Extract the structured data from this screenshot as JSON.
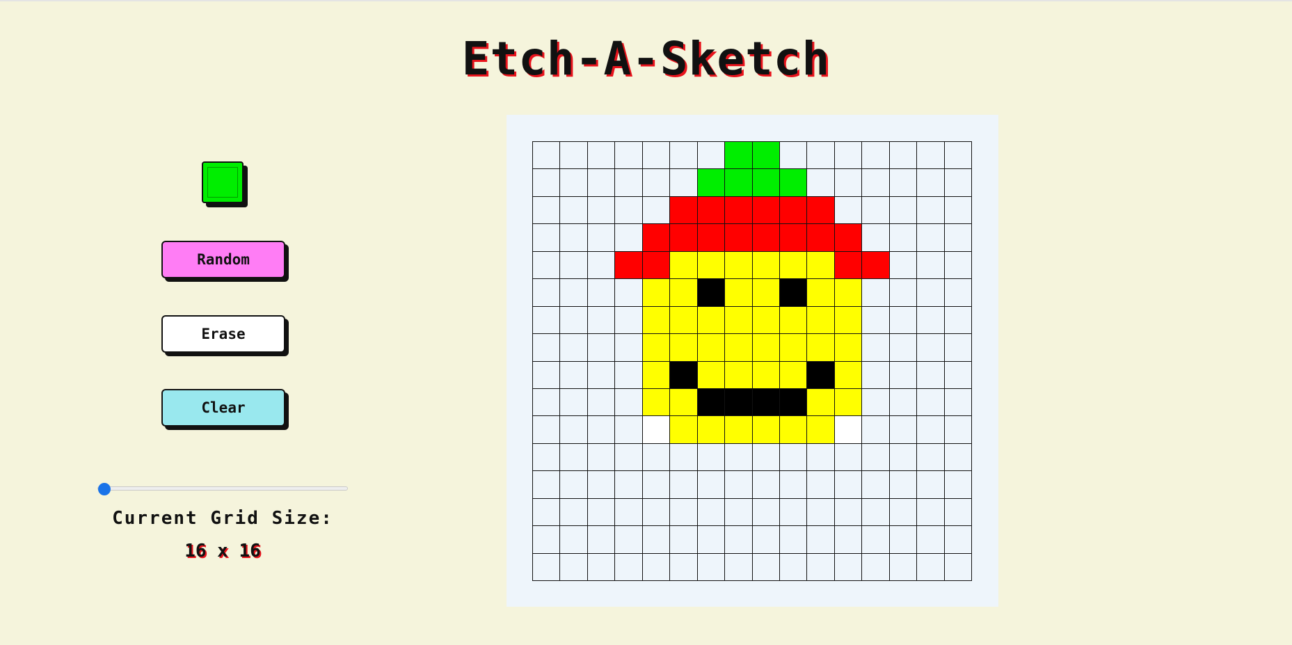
{
  "title": "Etch-A-Sketch",
  "current_color": "#00ee00",
  "buttons": {
    "random": {
      "label": "Random",
      "color": "#ff7df5"
    },
    "erase": {
      "label": "Erase",
      "color": "#ffffff"
    },
    "clear": {
      "label": "Clear",
      "color": "#99e8ee"
    }
  },
  "grid_size": {
    "label": "Current Grid Size:",
    "value": "16 x 16",
    "slider_value": 16
  },
  "palette": {
    "b": "#eef5fb",
    "G": "#00ee00",
    "R": "#ff0000",
    "Y": "#ffff00",
    "K": "#000000",
    "W": "#ffffff"
  },
  "grid_cells": [
    "bbbbbbbGGbbbbbbb",
    "bbbbbbGGGGbbbbbb",
    "bbbbbRRRRRRbbbbb",
    "bbbbRRRRRRRRbbbb",
    "bbbRRYYYYYYRRbbb",
    "bbbbYYKYYKYYbbbb",
    "bbbbYYYYYYYYbbbb",
    "bbbbYYYYYYYYbbbb",
    "bbbbYKYYYYKYbbbb",
    "bbbbYYKKKKYYbbbb",
    "bbbbWYYYYYYWbbbb",
    "bbbbbbbbbbbbbbbb",
    "bbbbbbbbbbbbbbbb",
    "bbbbbbbbbbbbbbbb",
    "bbbbbbbbbbbbbbbb",
    "bbbbbbbbbbbbbbbb"
  ]
}
